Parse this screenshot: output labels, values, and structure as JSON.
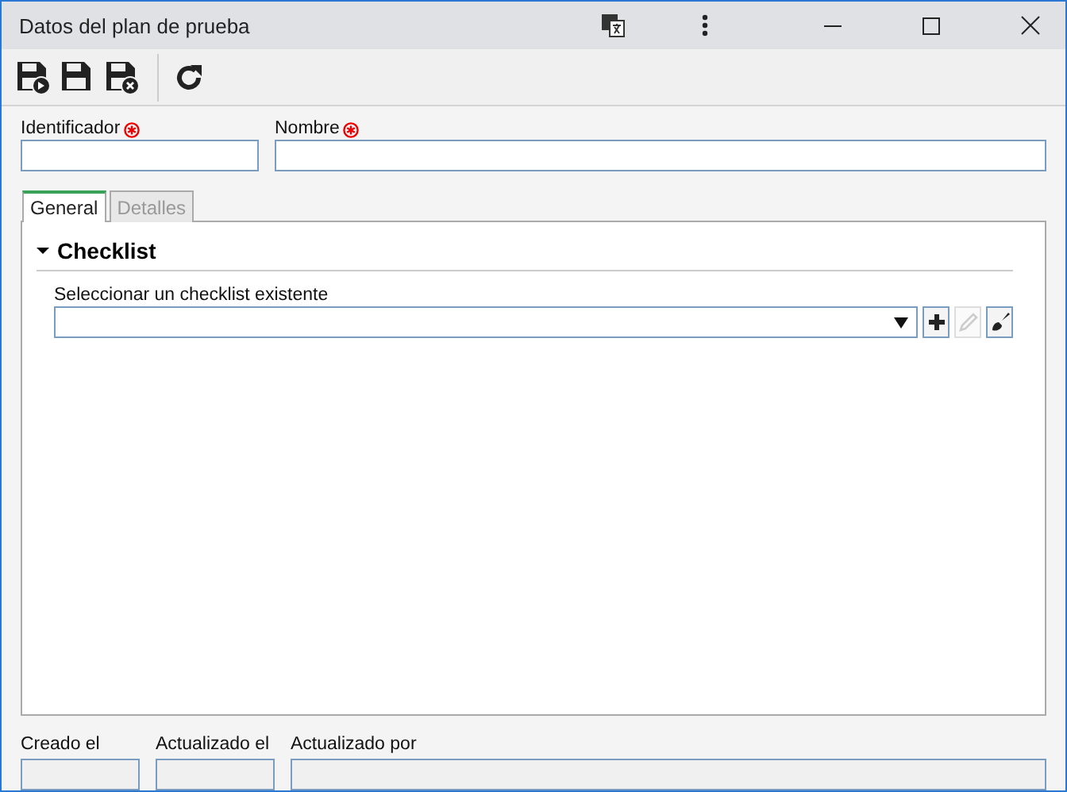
{
  "window": {
    "title": "Datos del plan de prueba"
  },
  "toolbar": [
    {
      "kind": "save-new"
    },
    {
      "kind": "save"
    },
    {
      "kind": "save-close"
    },
    {
      "kind": "refresh"
    }
  ],
  "fields": [
    {
      "label": "Identificador",
      "required": true
    },
    {
      "label": "Nombre",
      "required": true
    }
  ],
  "tabs": [
    {
      "label": "General",
      "selected": true
    },
    {
      "label": "Detalles",
      "selected": false
    }
  ],
  "section": {
    "title": "Checklist",
    "expanded": true,
    "select_label": "Seleccionar un checklist existente",
    "actions": [
      {
        "kind": "add",
        "disabled": false
      },
      {
        "kind": "edit",
        "disabled": true
      },
      {
        "kind": "clear",
        "disabled": false
      }
    ]
  },
  "footer": [
    {
      "label": "Creado el",
      "kind": "date"
    },
    {
      "label": "Actualizado el",
      "kind": "date"
    },
    {
      "label": "Actualizado por",
      "kind": "user"
    }
  ]
}
